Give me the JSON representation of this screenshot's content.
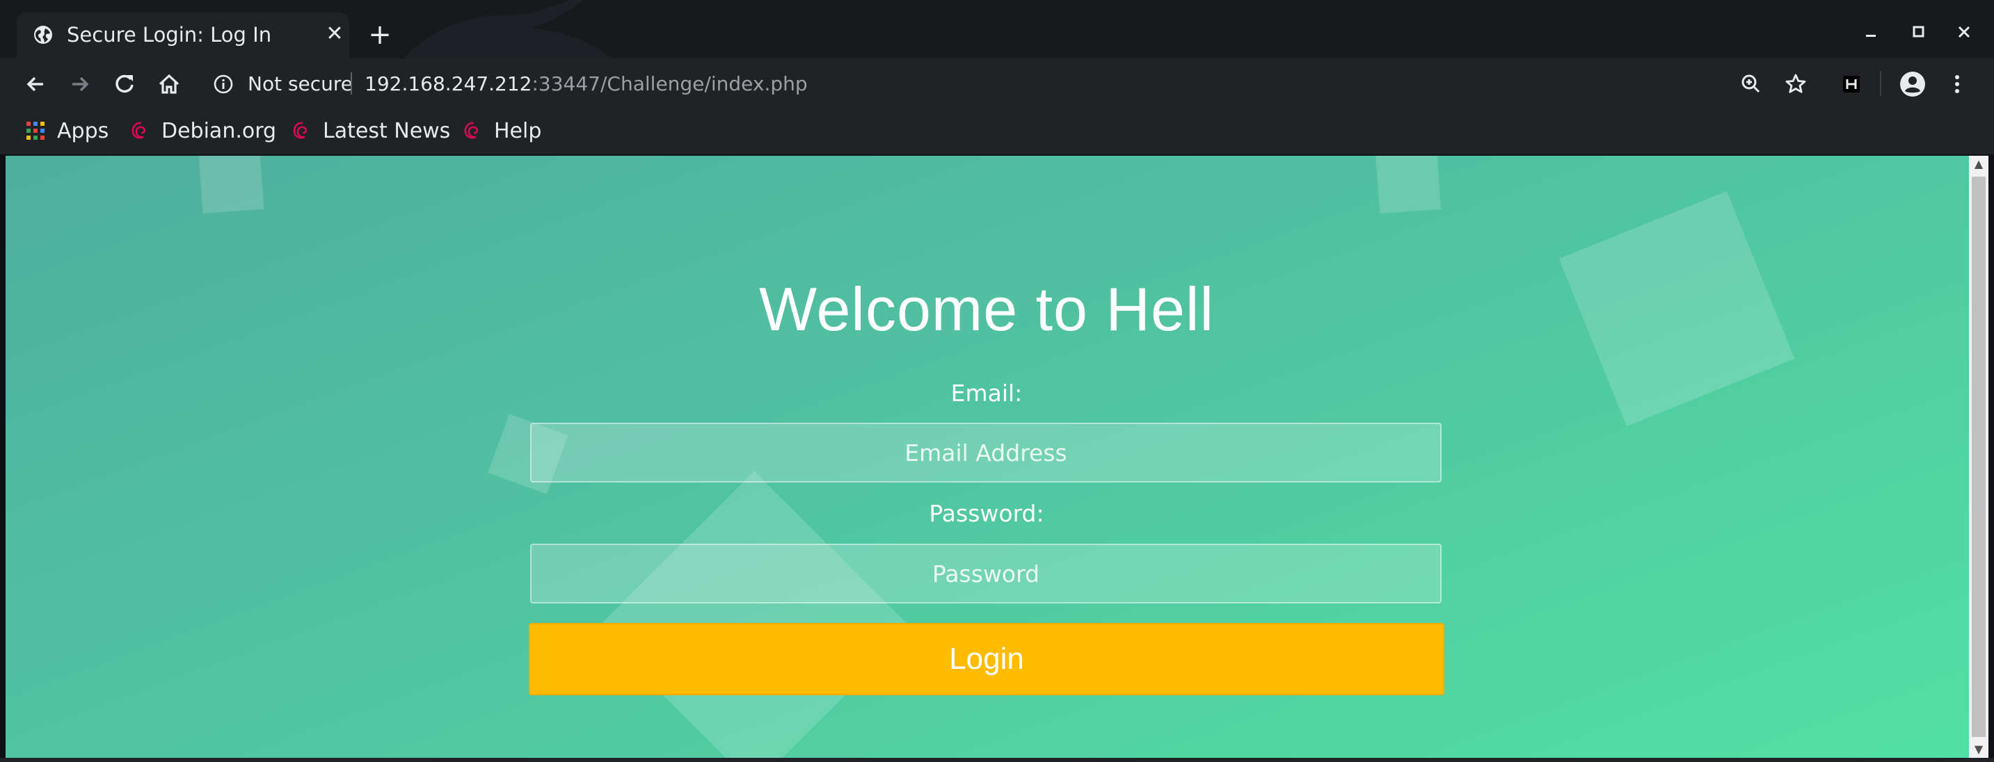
{
  "tab": {
    "title": "Secure Login: Log In",
    "close_glyph": "✕"
  },
  "new_tab_glyph": "+",
  "window_controls": {
    "minimize": "–",
    "maximize": "□",
    "close": "✕"
  },
  "toolbar": {
    "security_label": "Not secure",
    "url_host": "192.168.247.212",
    "url_rest": ":33447/Challenge/index.php"
  },
  "bookmarks": [
    {
      "label": "Apps",
      "icon": "apps-grid-icon"
    },
    {
      "label": "Debian.org",
      "icon": "debian-swirl-icon"
    },
    {
      "label": "Latest News",
      "icon": "debian-swirl-icon"
    },
    {
      "label": "Help",
      "icon": "debian-swirl-icon"
    }
  ],
  "page": {
    "title": "Welcome to Hell",
    "email_label": "Email:",
    "email_placeholder": "Email Address",
    "password_label": "Password:",
    "password_placeholder": "Password",
    "login_label": "Login"
  },
  "colors": {
    "gradient_start": "#4fae9e",
    "gradient_end": "#53dfa5",
    "login_button": "#ffbb00"
  }
}
